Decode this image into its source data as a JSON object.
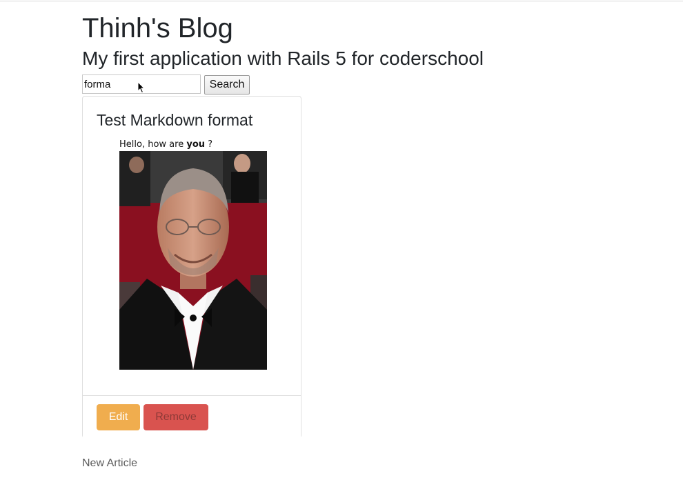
{
  "header": {
    "title": "Thinh's Blog",
    "subtitle": "My first application with Rails 5 for coderschool"
  },
  "search": {
    "value": "forma",
    "button_label": "Search"
  },
  "article": {
    "title": "Test Markdown format",
    "body_prefix": "Hello, how are ",
    "body_bold": "you",
    "body_suffix": " ?",
    "actions": {
      "edit_label": "Edit",
      "remove_label": "Remove"
    }
  },
  "footer": {
    "new_article_label": "New Article"
  },
  "colors": {
    "edit_button": "#f0ad4e",
    "remove_button": "#d9534f",
    "text": "#212529"
  }
}
